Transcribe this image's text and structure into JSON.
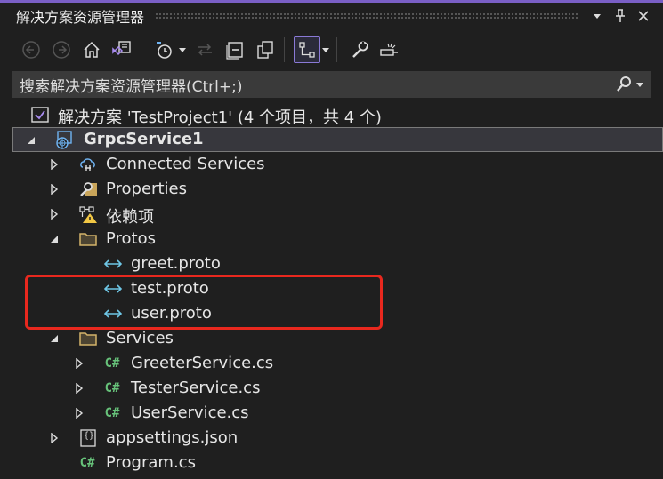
{
  "window": {
    "title": "解决方案资源管理器"
  },
  "search": {
    "placeholder": "搜索解决方案资源管理器(Ctrl+;)"
  },
  "tree": {
    "solution": "解决方案 'TestProject1' (4 个项目，共 4 个)",
    "project": "GrpcService1",
    "items": {
      "connected": "Connected Services",
      "properties": "Properties",
      "deps": "依赖项",
      "protos": "Protos",
      "greet": "greet.proto",
      "test": "test.proto",
      "user": "user.proto",
      "services": "Services",
      "greeter": "GreeterService.cs",
      "tester": "TesterService.cs",
      "userservice": "UserService.cs",
      "appsettings": "appsettings.json",
      "program": "Program.cs"
    },
    "cs_badge": "C#",
    "json_badge": "{}"
  },
  "colors": {
    "accent": "#7a5fc6",
    "highlight": "#e8281e",
    "background": "#1f1f1f"
  }
}
